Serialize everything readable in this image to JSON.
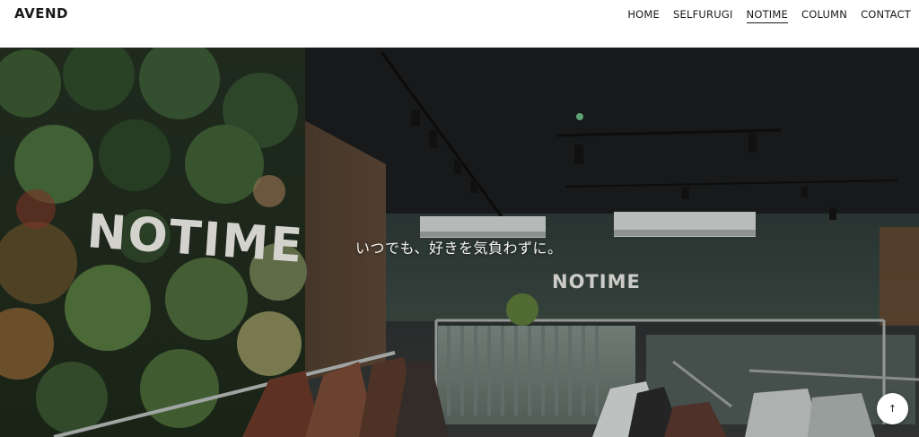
{
  "header": {
    "logo": "AVEND",
    "nav": [
      {
        "label": "HOME",
        "active": false
      },
      {
        "label": "SELFURUGI",
        "active": false
      },
      {
        "label": "NOTIME",
        "active": true
      },
      {
        "label": "COLUMN",
        "active": false
      },
      {
        "label": "CONTACT",
        "active": false
      }
    ]
  },
  "hero": {
    "tagline": "いつでも、好きを気負わずに。",
    "wall_sign": "NOTIME",
    "back_sign": "NOTIME",
    "back_to_top_icon": "arrow-up-icon",
    "back_to_top_glyph": "↑"
  }
}
